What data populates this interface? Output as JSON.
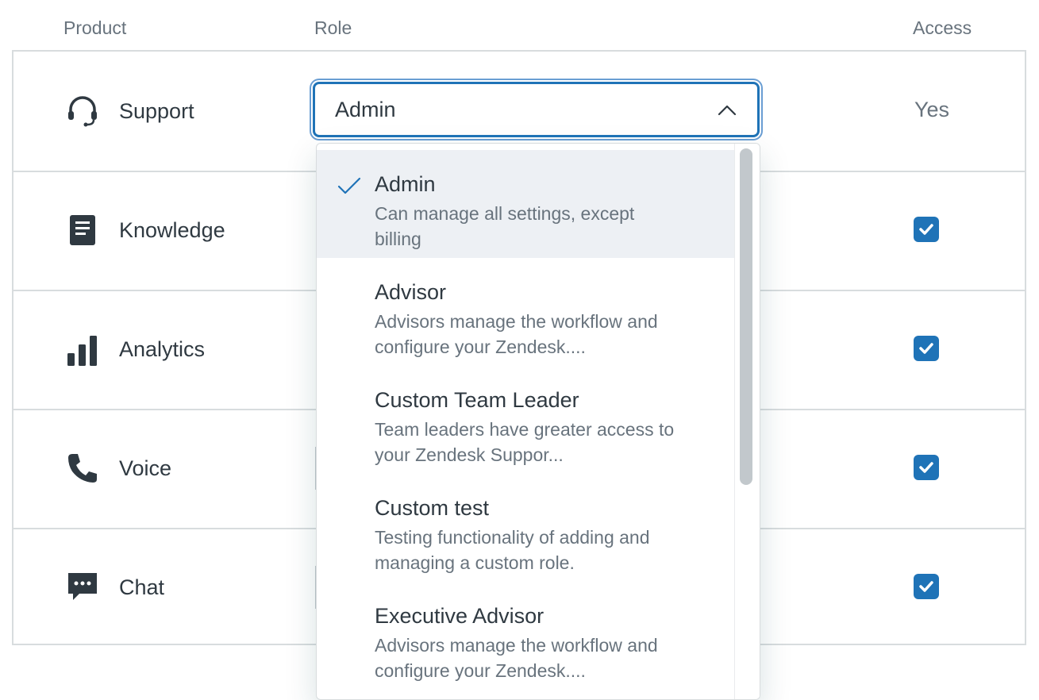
{
  "headers": {
    "product": "Product",
    "role": "Role",
    "access": "Access"
  },
  "rows": [
    {
      "icon": "headset-icon",
      "name": "Support",
      "access_text": "Yes"
    },
    {
      "icon": "book-icon",
      "name": "Knowledge",
      "access_checked": true
    },
    {
      "icon": "bar-chart-icon",
      "name": "Analytics",
      "access_checked": true
    },
    {
      "icon": "phone-icon",
      "name": "Voice",
      "access_checked": true
    },
    {
      "icon": "chat-bubble-icon",
      "name": "Chat",
      "access_checked": true
    }
  ],
  "role_select": {
    "value": "Admin",
    "options": [
      {
        "title": "Admin",
        "description": "Can manage all settings, except billing",
        "selected": true
      },
      {
        "title": "Advisor",
        "description": "Advisors manage the workflow and configure your Zendesk...."
      },
      {
        "title": "Custom Team Leader",
        "description": "Team leaders have greater access to your Zendesk Suppor..."
      },
      {
        "title": "Custom test",
        "description": "Testing functionality of adding and managing a custom role."
      },
      {
        "title": "Executive Advisor",
        "description": "Advisors manage the workflow and configure your Zendesk...."
      }
    ]
  },
  "colors": {
    "accent": "#1f73b7",
    "text": "#2f3941",
    "muted": "#68737d",
    "border": "#d8dcde",
    "selected_bg": "#edf0f4"
  }
}
